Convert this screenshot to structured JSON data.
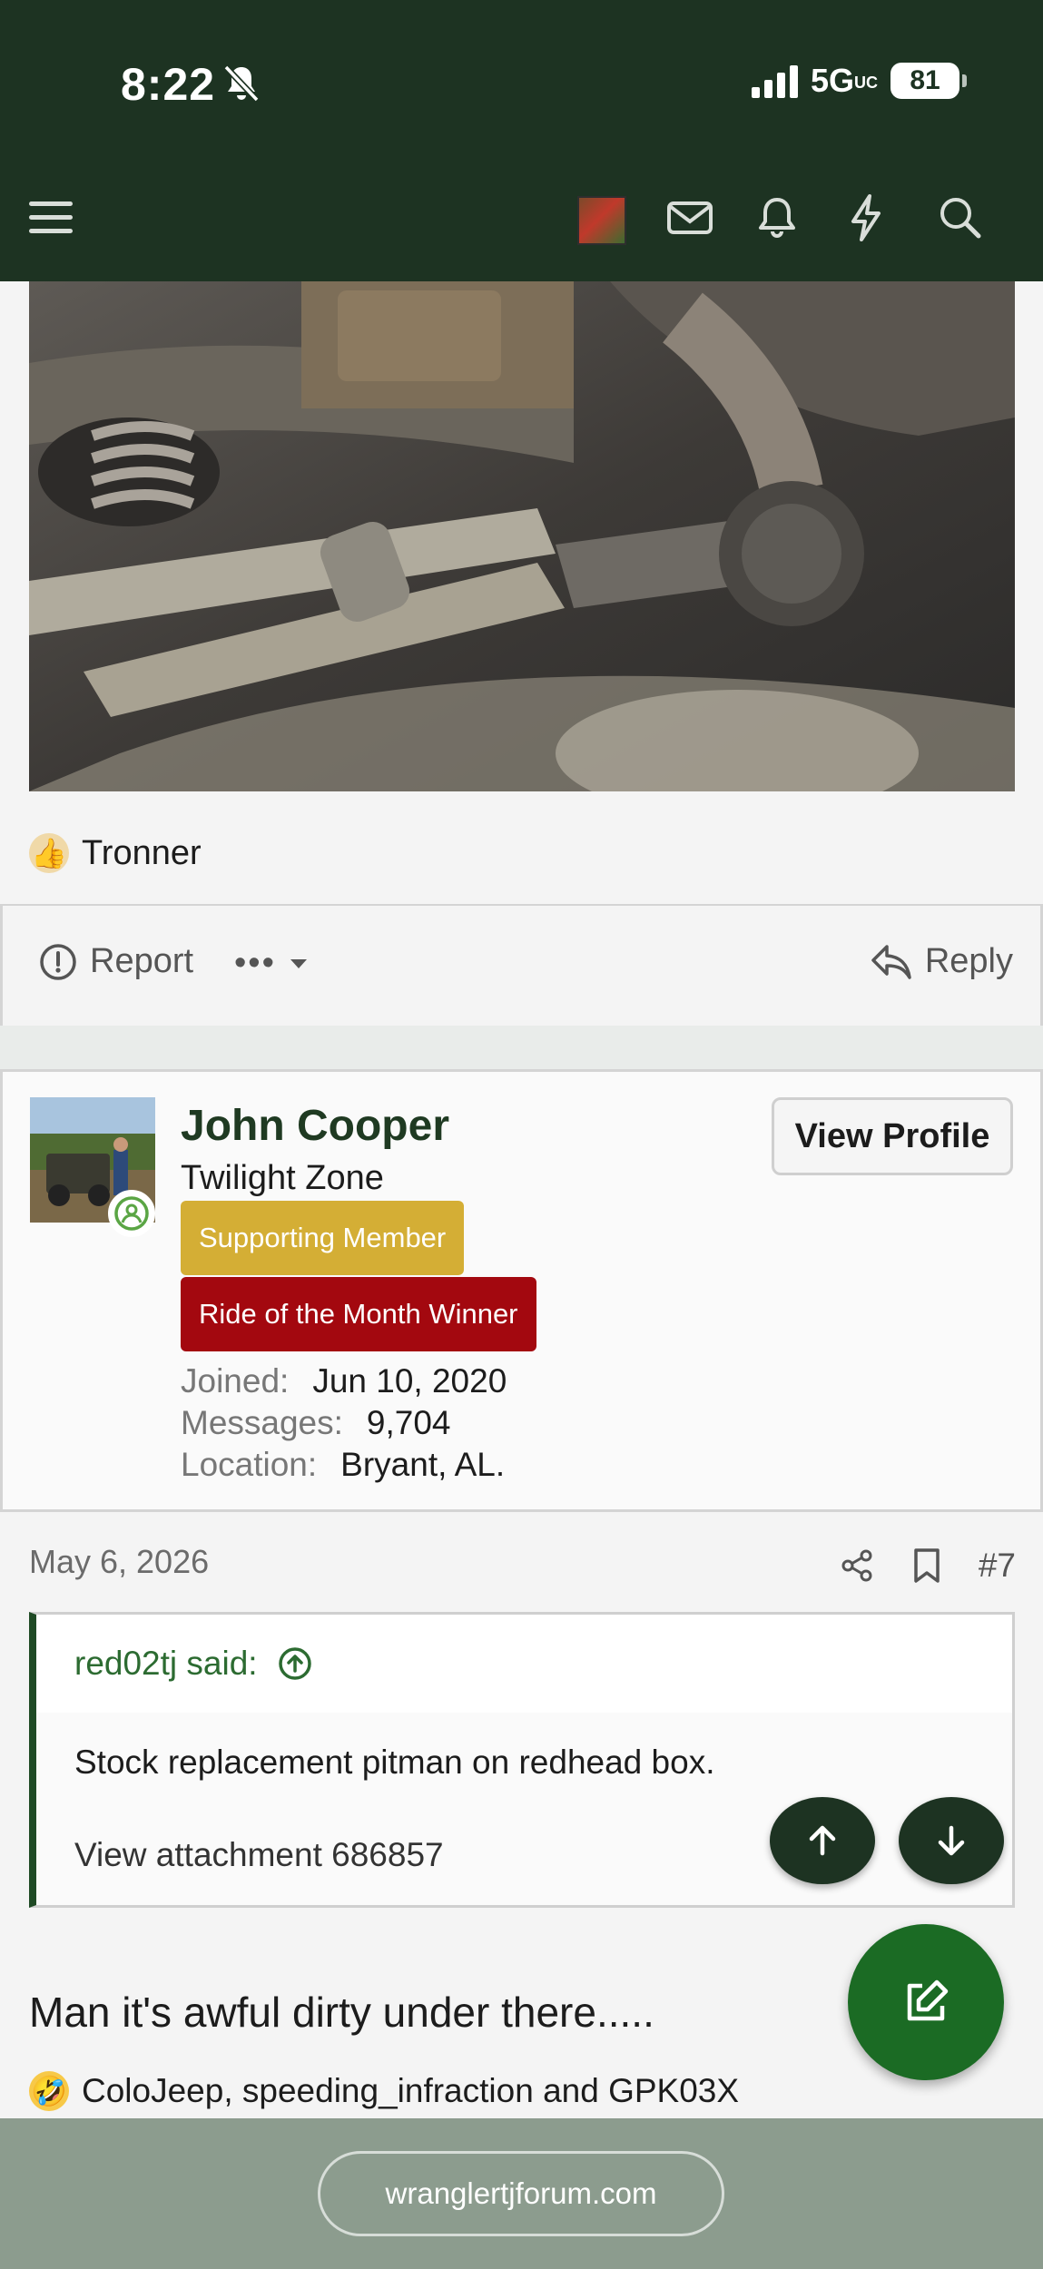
{
  "status_bar": {
    "time": "8:22",
    "network": "5G",
    "network_suffix": "UC",
    "battery": "81"
  },
  "header": {
    "icons": [
      "menu-icon",
      "user-avatar",
      "inbox-icon",
      "alerts-icon",
      "whats-new-icon",
      "search-icon"
    ]
  },
  "prev_post": {
    "reaction_user": "Tronner",
    "actions": {
      "report": "Report",
      "more": "•••",
      "reply": "Reply"
    }
  },
  "post": {
    "user": {
      "name": "John Cooper",
      "title": "Twilight Zone",
      "banners": [
        "Supporting Member",
        "Ride of the Month Winner"
      ],
      "stats": [
        {
          "label": "Joined:",
          "value": "Jun 10, 2020"
        },
        {
          "label": "Messages:",
          "value": "9,704"
        },
        {
          "label": "Location:",
          "value": "Bryant, AL."
        }
      ],
      "view_profile": "View Profile"
    },
    "date": "May 6, 2026",
    "number": "#7",
    "quote": {
      "author": "red02tj said:",
      "text": "Stock replacement pitman on redhead box.",
      "attachment": "View attachment 686857"
    },
    "body": "Man it's awful dirty under there.....",
    "reactions": "ColoJeep, speeding_infraction and GPK03X"
  },
  "browser": {
    "url": "wranglertjforum.com"
  },
  "colors": {
    "header_bg": "#1d3322",
    "accent": "#1b6b24",
    "badge_gold": "#d4ae35",
    "badge_red": "#a3080f"
  }
}
